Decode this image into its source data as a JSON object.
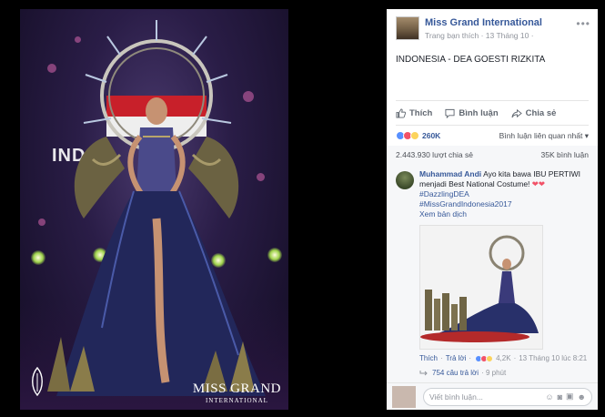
{
  "photo": {
    "stage_text": "INDO",
    "watermark_brand": "MISS GRAND",
    "watermark_sub": "INTERNATIONAL"
  },
  "post": {
    "page_name": "Miss Grand International",
    "meta": "Trang bạn thích · 13 Tháng 10 ·",
    "caption": "INDONESIA - DEA GOESTI RIZKITA",
    "actions": {
      "like": "Thích",
      "comment": "Bình luận",
      "share": "Chia sẻ"
    },
    "reactions_count": "260K",
    "sort_label": "Bình luận liên quan nhất ▾",
    "shares": "2.443.930 lượt chia sẻ",
    "comments_count": "35K bình luận"
  },
  "comment": {
    "author": "Muhammad Andi",
    "text": "Ayo kita bawa IBU PERTIWI menjadi Best National Costume!",
    "hearts": "❤❤",
    "hashtag1": "#DazzlingDEA",
    "hashtag2": "#MissGrandIndonesia2017",
    "translate": "Xem bản dịch",
    "like": "Thích",
    "reply": "Trả lời",
    "reaction_count": "4,2K",
    "timestamp": "13 Tháng 10 lúc 8:21",
    "replies": "754 câu trả lời",
    "replies_time": "· 9 phút"
  },
  "composer": {
    "placeholder": "Viết bình luận...",
    "icons": [
      "emoji-icon",
      "camera-icon",
      "gif-icon",
      "sticker-icon"
    ]
  },
  "colors": {
    "link": "#365899",
    "muted": "#90949c",
    "like_blue": "#5890ff",
    "love_red": "#f25268",
    "wow_yellow": "#fcd35c"
  }
}
